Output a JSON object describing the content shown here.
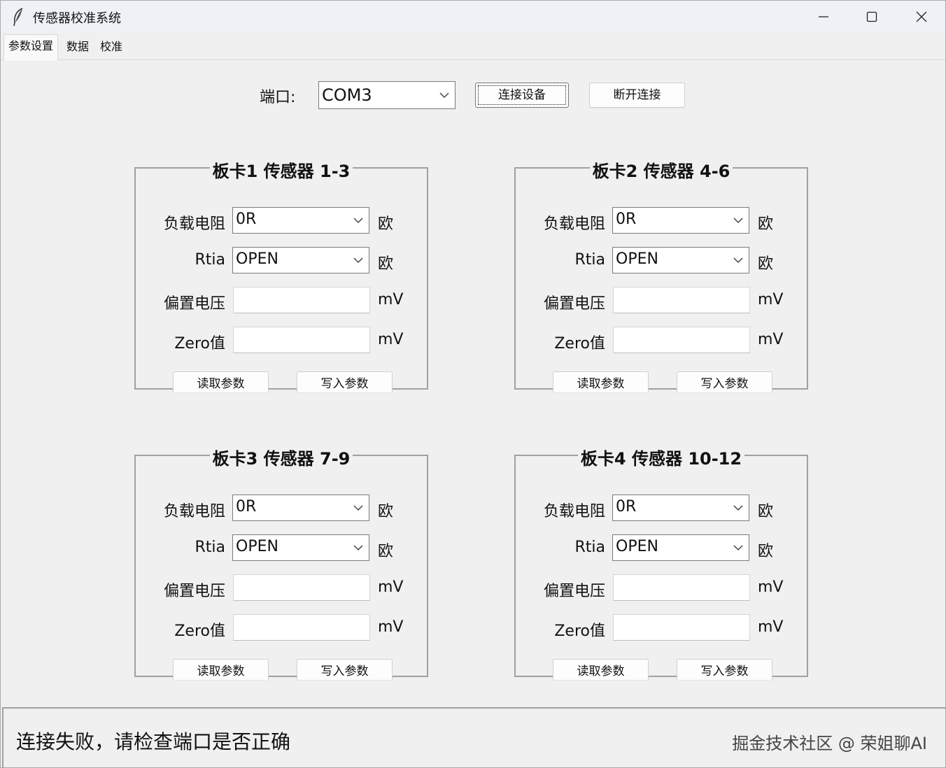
{
  "window": {
    "title": "传感器校准系统"
  },
  "tabs": [
    {
      "label": "参数设置"
    },
    {
      "label": "数据"
    },
    {
      "label": "校准"
    }
  ],
  "connection": {
    "port_label": "端口:",
    "port_value": "COM3",
    "connect_label": "连接设备",
    "disconnect_label": "断开连接"
  },
  "boards": [
    {
      "title": "板卡1 传感器 1-3",
      "load_label": "负载电阻",
      "load_value": "0R",
      "load_unit": "欧",
      "rtia_label": "Rtia",
      "rtia_value": "OPEN",
      "rtia_unit": "欧",
      "bias_label": "偏置电压",
      "bias_value": "",
      "bias_unit": "mV",
      "zero_label": "Zero值",
      "zero_value": "",
      "zero_unit": "mV",
      "read_label": "读取参数",
      "write_label": "写入参数"
    },
    {
      "title": "板卡2 传感器 4-6",
      "load_label": "负载电阻",
      "load_value": "0R",
      "load_unit": "欧",
      "rtia_label": "Rtia",
      "rtia_value": "OPEN",
      "rtia_unit": "欧",
      "bias_label": "偏置电压",
      "bias_value": "",
      "bias_unit": "mV",
      "zero_label": "Zero值",
      "zero_value": "",
      "zero_unit": "mV",
      "read_label": "读取参数",
      "write_label": "写入参数"
    },
    {
      "title": "板卡3 传感器 7-9",
      "load_label": "负载电阻",
      "load_value": "0R",
      "load_unit": "欧",
      "rtia_label": "Rtia",
      "rtia_value": "OPEN",
      "rtia_unit": "欧",
      "bias_label": "偏置电压",
      "bias_value": "",
      "bias_unit": "mV",
      "zero_label": "Zero值",
      "zero_value": "",
      "zero_unit": "mV",
      "read_label": "读取参数",
      "write_label": "写入参数"
    },
    {
      "title": "板卡4 传感器 10-12",
      "load_label": "负载电阻",
      "load_value": "0R",
      "load_unit": "欧",
      "rtia_label": "Rtia",
      "rtia_value": "OPEN",
      "rtia_unit": "欧",
      "bias_label": "偏置电压",
      "bias_value": "",
      "bias_unit": "mV",
      "zero_label": "Zero值",
      "zero_value": "",
      "zero_unit": "mV",
      "read_label": "读取参数",
      "write_label": "写入参数"
    }
  ],
  "status": {
    "message": "连接失败，请检查端口是否正确",
    "watermark": "掘金技术社区 @ 荣姐聊AI"
  },
  "icons": {
    "app": "feather-icon",
    "minimize": "minimize-icon",
    "maximize": "maximize-icon",
    "close": "close-icon",
    "dropdown": "chevron-down-icon"
  }
}
